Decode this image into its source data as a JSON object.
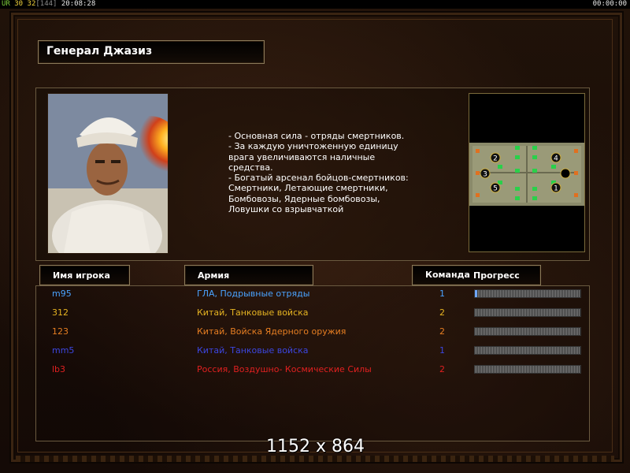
{
  "status_bar": {
    "ur": "UR",
    "n1": "30",
    "n2": "32",
    "bracket": "[144]",
    "clock": "20:08:28",
    "timer": "00:00:00"
  },
  "general": {
    "title": "Генерал Джазиз",
    "description": [
      "- Основная сила - отряды смертников.",
      "- За каждую уничтоженную единицу",
      "  врага увеличиваются наличные",
      "  средства.",
      "- Богатый арсенал бойцов-смертников:",
      "  Смертники, Летающие смертники,",
      "  Бомбовозы, Ядерные бомбовозы,",
      "  Ловушки со взрывчаткой"
    ]
  },
  "map": {
    "start_positions": [
      "2",
      "4",
      "3",
      "5",
      "1"
    ]
  },
  "table": {
    "headers": {
      "player": "Имя игрока",
      "army": "Армия",
      "team": "Команда",
      "progress": "Прогресс"
    },
    "rows": [
      {
        "name": "m95",
        "army": "ГЛА, Подрывные отряды",
        "team": "1",
        "color": "#4aa3ff",
        "progress": 0.02
      },
      {
        "name": "312",
        "army": "Китай, Танковые войска",
        "team": "2",
        "color": "#e6b422",
        "progress": 0.0
      },
      {
        "name": "123",
        "army": "Китай, Войска Ядерного оружия",
        "team": "2",
        "color": "#e67e22",
        "progress": 0.0
      },
      {
        "name": "mm5",
        "army": "Китай, Танковые войска",
        "team": "1",
        "color": "#3c46e0",
        "progress": 0.0
      },
      {
        "name": "lb3",
        "army": "Россия, Воздушно- Космические Силы",
        "team": "2",
        "color": "#e02020",
        "progress": 0.0
      }
    ]
  },
  "watermark": "1152 x 864"
}
